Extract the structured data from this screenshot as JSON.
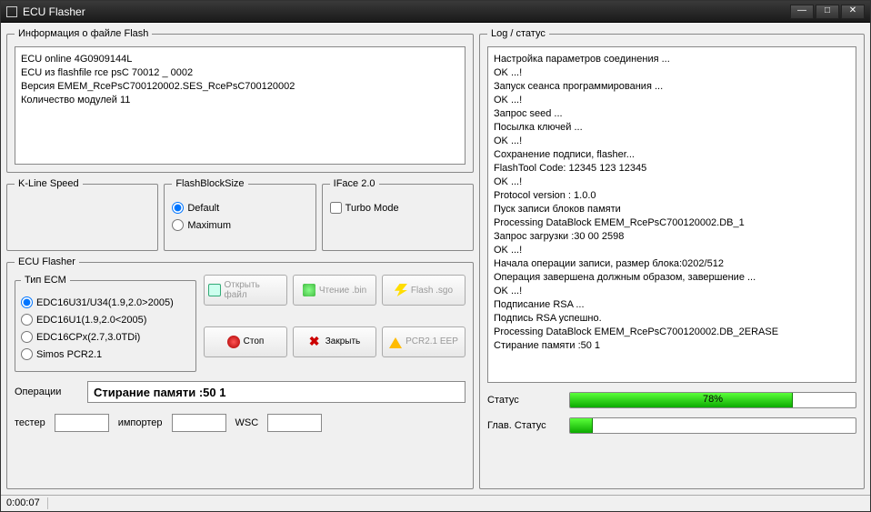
{
  "window": {
    "title": "ECU Flasher"
  },
  "flashinfo": {
    "legend": "Информация о файле Flash",
    "lines": [
      "ECU online 4G0909144L",
      "ECU из flashfile rce psC 70012 _ 0002",
      "Версия EMEM_RcePsC700120002.SES_RcePsC700120002",
      "Количество модулей 11"
    ]
  },
  "kline": {
    "legend": "K-Line Speed"
  },
  "flashblock": {
    "legend": "FlashBlockSize",
    "options": {
      "default": "Default",
      "maximum": "Maximum"
    },
    "selected": "default"
  },
  "iface": {
    "legend": "IFace 2.0",
    "turbo": "Turbo Mode",
    "turbo_checked": false
  },
  "ecuflasher": {
    "legend": "ECU Flasher",
    "ecm_legend": "Тип ECM",
    "ecm_options": [
      "EDC16U31/U34(1.9,2.0>2005)",
      "EDC16U1(1.9,2.0<2005)",
      "EDC16CPx(2.7,3.0TDi)",
      "Simos PCR2.1"
    ],
    "ecm_selected": 0,
    "buttons": {
      "open": "Открыть файл",
      "read": "Чтение .bin",
      "flash": "Flash .sgo",
      "stop": "Стоп",
      "close": "Закрыть",
      "pcr": "PCR2.1 EEP"
    },
    "operations_label": "Операции",
    "operations_value": "Стирание памяти :50 1",
    "tester_label": "тестер",
    "importer_label": "импортер",
    "wsc_label": "WSC"
  },
  "log": {
    "legend": "Log / статус",
    "lines": [
      "Настройка параметров соединения ...",
      "OK ...!",
      "Запуск сеанса программирования ...",
      "OK ...!",
      "Запрос seed ...",
      "Посылка ключей ...",
      "OK ...!",
      "Сохранение подписи, flasher...",
      "FlashTool Code: 12345 123 12345",
      "OK ...!",
      "Protocol version : 1.0.0",
      "Пуск записи блоков памяти",
      "Processing DataBlock EMEM_RcePsC700120002.DB_1",
      "Запрос загрузки :30 00 2598",
      "OK ...!",
      "Начала операции записи, размер блока:0202/512",
      "Операция завершена должным образом, завершение ...",
      "OK ...!",
      "Подписание RSA ...",
      "Подпись RSA успешно.",
      "Processing DataBlock EMEM_RcePsC700120002.DB_2ERASE",
      "Стирание памяти :50 1"
    ],
    "status_label": "Статус",
    "status_pct": 78,
    "main_status_label": "Глав. Статус",
    "main_status_pct": 8
  },
  "statusbar": {
    "time": "0:00:07"
  }
}
